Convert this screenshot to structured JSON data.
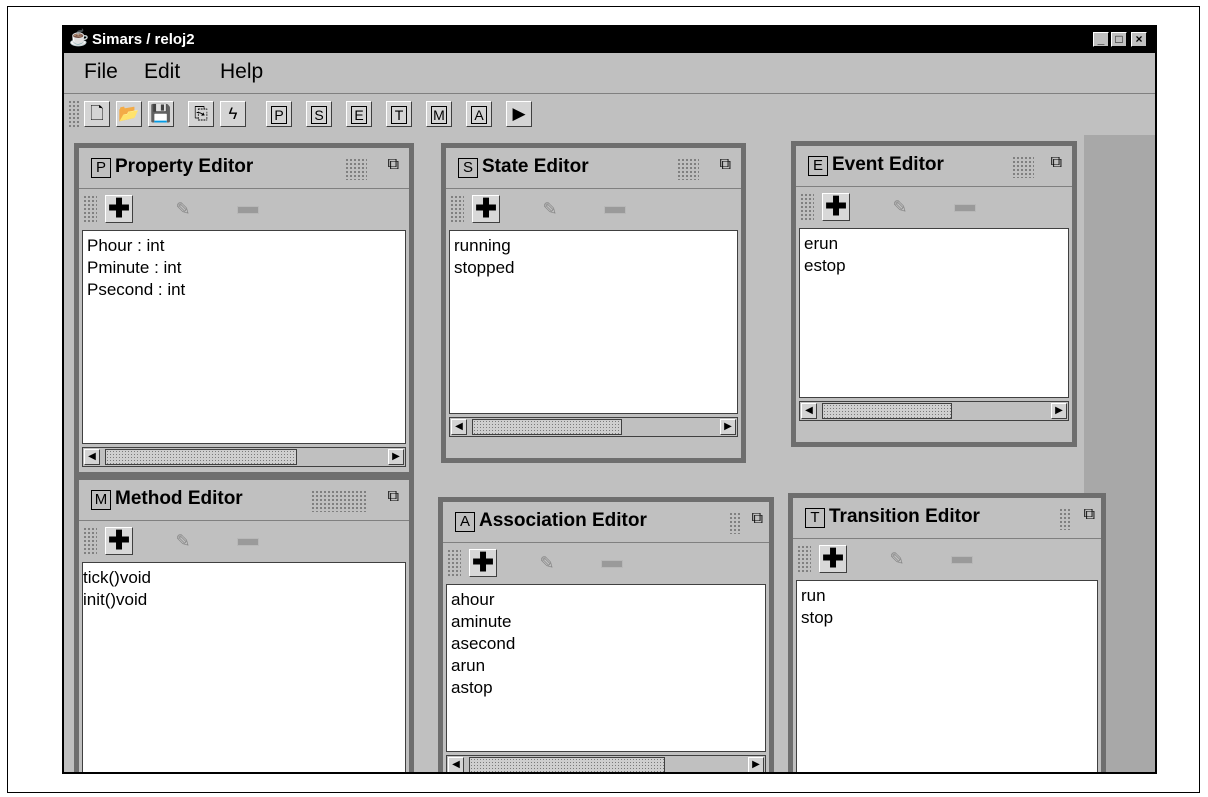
{
  "window": {
    "title": "Simars / reloj2",
    "app_icon": "java-cup-icon",
    "minimize": "_",
    "maximize": "□",
    "close": "×"
  },
  "menu": [
    "File",
    "Edit",
    "Help"
  ],
  "toolbar": {
    "icons": [
      "new-file-icon",
      "open-folder-icon",
      "save-disk-icon",
      "copy-icon",
      "generate-lightning-icon"
    ],
    "editor_buttons": [
      "P",
      "S",
      "E",
      "T",
      "M",
      "A"
    ],
    "glyphs": {
      "new": "🗋",
      "open": "📂",
      "save": "💾",
      "copy": "⎘",
      "bolt": "ϟ",
      "last": "▶"
    }
  },
  "controls": {
    "add": "✚",
    "edit": "✎",
    "maximize": "⧉",
    "arrow_left": "◀",
    "arrow_right": "▶"
  },
  "panels": {
    "property": {
      "letter": "P",
      "title": "Property Editor",
      "items": [
        "Phour : int",
        "Pminute : int",
        "Psecond : int"
      ]
    },
    "state": {
      "letter": "S",
      "title": "State Editor",
      "items": [
        "running",
        "stopped"
      ]
    },
    "event": {
      "letter": "E",
      "title": "Event Editor",
      "items": [
        "erun",
        "estop"
      ]
    },
    "method": {
      "letter": "M",
      "title": "Method Editor",
      "items": [
        "tick()void",
        "init()void"
      ]
    },
    "association": {
      "letter": "A",
      "title": "Association Editor",
      "items": [
        "ahour",
        "aminute",
        "asecond",
        "arun",
        "astop"
      ]
    },
    "transition": {
      "letter": "T",
      "title": "Transition Editor",
      "items": [
        "run",
        "stop"
      ]
    }
  },
  "colors": {
    "titlebar": "#000000",
    "desktop": "#c0c0c0",
    "panel_border": "#6e6e6e",
    "list_bg": "#ffffff"
  }
}
